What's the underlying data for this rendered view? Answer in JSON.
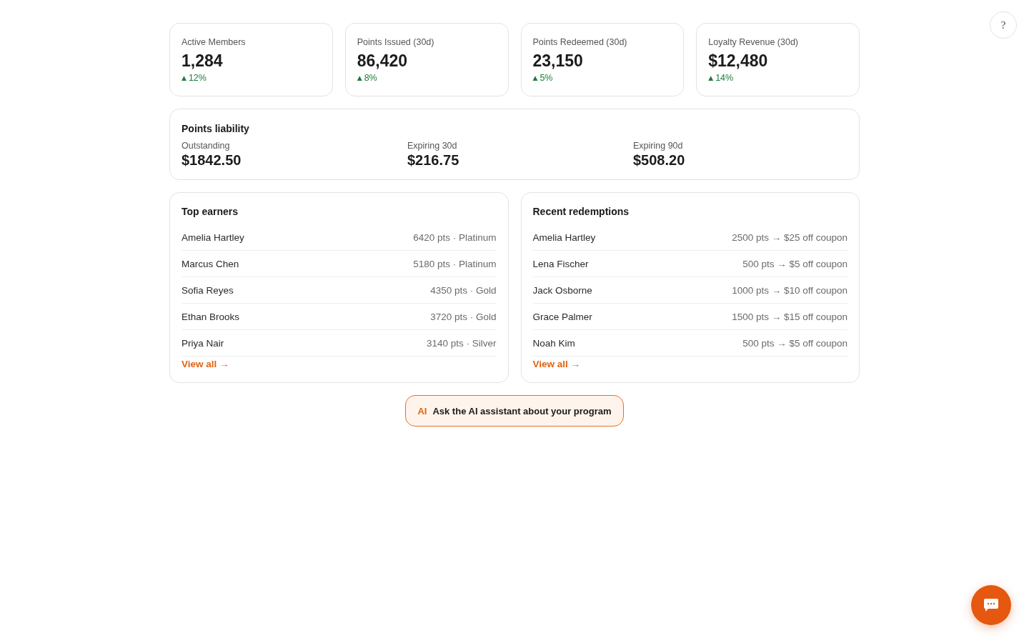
{
  "help_button": {
    "label": "?"
  },
  "stats": [
    {
      "label": "Active Members",
      "value": "1,284",
      "trend": {
        "arrow": "▲",
        "change": "12%"
      }
    },
    {
      "label": "Points Issued (30d)",
      "value": "86,420",
      "trend": {
        "arrow": "▲",
        "change": "8%"
      }
    },
    {
      "label": "Points Redeemed (30d)",
      "value": "23,150",
      "trend": {
        "arrow": "▲",
        "change": "5%"
      }
    },
    {
      "label": "Loyalty Revenue (30d)",
      "value": "$12,480",
      "trend": {
        "arrow": "▲",
        "change": "14%"
      }
    }
  ],
  "liability": {
    "title": "Points liability",
    "items": [
      {
        "label": "Outstanding",
        "value": "$1842.50"
      },
      {
        "label": "Expiring 30d",
        "value": "$216.75"
      },
      {
        "label": "Expiring 90d",
        "value": "$508.20"
      }
    ]
  },
  "lists": [
    {
      "title": "Top earners",
      "rows": [
        {
          "name": "Amelia Hartley",
          "detail": "6420 pts · Platinum"
        },
        {
          "name": "Marcus Chen",
          "detail": "5180 pts · Platinum"
        },
        {
          "name": "Sofia Reyes",
          "detail": "4350 pts · Gold"
        },
        {
          "name": "Ethan Brooks",
          "detail": "3720 pts · Gold"
        },
        {
          "name": "Priya Nair",
          "detail": "3140 pts · Silver"
        }
      ],
      "link": "View all →"
    },
    {
      "title": "Recent redemptions",
      "rows": [
        {
          "name": "Amelia Hartley",
          "detail": "2500 pts → $25 off coupon"
        },
        {
          "name": "Lena Fischer",
          "detail": "500 pts → $5 off coupon"
        },
        {
          "name": "Jack Osborne",
          "detail": "1000 pts → $10 off coupon"
        },
        {
          "name": "Grace Palmer",
          "detail": "1500 pts → $15 off coupon"
        },
        {
          "name": "Noah Kim",
          "detail": "500 pts → $5 off coupon"
        }
      ],
      "link": "View all →"
    }
  ],
  "assistant_button": {
    "tag": "AI",
    "label": "Ask the AI assistant about your program"
  }
}
